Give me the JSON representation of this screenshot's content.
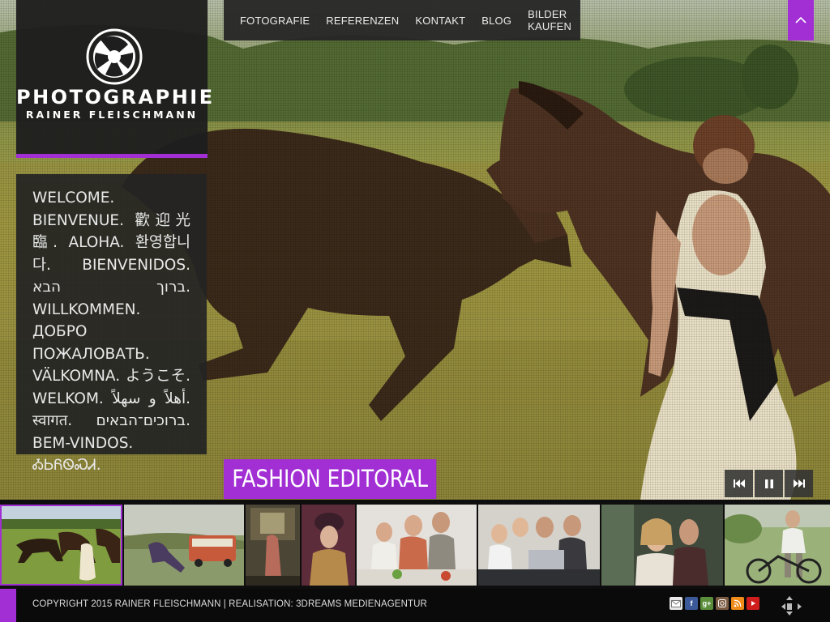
{
  "nav": {
    "items": [
      "FOTOGRAFIE",
      "REFERENZEN",
      "KONTAKT",
      "BLOG",
      "BILDER KAUFEN"
    ]
  },
  "logo": {
    "title": "PHOTOGRAPHIE",
    "subtitle": "RAINER FLEISCHMANN"
  },
  "welcome": {
    "text": "WELCOME. BIENVENUE. 歡迎光臨. ALOHA. 환영합니다. BIENVENIDOS. ברוך הבא. WILLKOMMEN. ДОБРО ПОЖАЛОВАТЬ. VÄLKOMNA. ようこそ. WELKOM. أهلاً و سهلاً. स्वागत. ברוכים־הבאים. BEM-VINDOS. ᎣᏏᏲᏫᏍᏗ."
  },
  "slideshow": {
    "caption": "FASHION EDITORAL",
    "controls": [
      "previous-icon",
      "pause-icon",
      "next-icon"
    ]
  },
  "thumbnails": [
    {
      "name": "horses-meadow",
      "active": true
    },
    {
      "name": "camper-van"
    },
    {
      "name": "vintage-room"
    },
    {
      "name": "costume-portrait"
    },
    {
      "name": "family-kitchen"
    },
    {
      "name": "family-laptop"
    },
    {
      "name": "couple-portrait"
    },
    {
      "name": "man-bicycle"
    }
  ],
  "footer": {
    "copyright": "COPYRIGHT 2015 RAINER FLEISCHMANN | REALISATION: 3DREAMS MEDIENAGENTUR",
    "social": [
      "mail-icon",
      "facebook-icon",
      "google-plus-icon",
      "instagram-icon",
      "rss-icon",
      "youtube-icon"
    ]
  },
  "colors": {
    "accent": "#a12fd4",
    "panel": "#262626"
  }
}
